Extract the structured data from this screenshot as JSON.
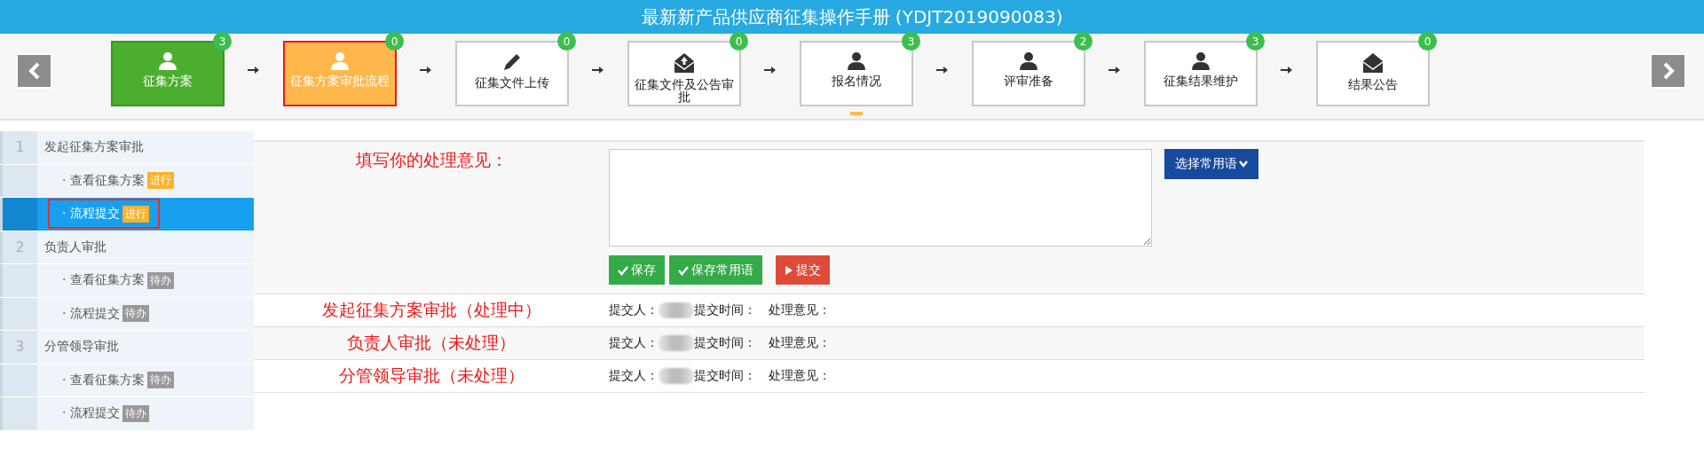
{
  "window": {
    "title": "最新新产品供应商征集操作手册 (YDJT2019090083)"
  },
  "steps": [
    {
      "label": "征集方案",
      "count": "3",
      "done": true,
      "selected": false,
      "current": false
    },
    {
      "label": "征集方案审批流程",
      "count": "0",
      "done": false,
      "selected": true,
      "current": false
    },
    {
      "label": "征集文件上传",
      "count": "0",
      "done": false,
      "selected": false,
      "current": false
    },
    {
      "label": "征集文件及公告审批",
      "count": "0",
      "done": false,
      "selected": false,
      "current": false
    },
    {
      "label": "报名情况",
      "count": "3",
      "done": false,
      "selected": false,
      "current": true
    },
    {
      "label": "评审准备",
      "count": "2",
      "done": false,
      "selected": false,
      "current": false
    },
    {
      "label": "征集结果维护",
      "count": "3",
      "done": false,
      "selected": false,
      "current": false
    },
    {
      "label": "结果公告",
      "count": "0",
      "done": false,
      "selected": false,
      "current": false
    }
  ],
  "sidebar": {
    "groups": [
      {
        "number": "1",
        "title": "发起征集方案审批",
        "children": [
          {
            "label": "· 查看征集方案",
            "badge": {
              "text": "进行",
              "color": "#fbb22c"
            },
            "selected": false
          },
          {
            "label": "· 流程提交",
            "badge": {
              "text": "进行",
              "color": "#fbb22c"
            },
            "selected": true
          }
        ]
      },
      {
        "number": "2",
        "title": "负责人审批",
        "children": [
          {
            "label": "· 查看征集方案",
            "badge": {
              "text": "待办",
              "color": "#999999"
            },
            "selected": false
          },
          {
            "label": "· 流程提交",
            "badge": {
              "text": "待办",
              "color": "#999999"
            },
            "selected": false
          }
        ]
      },
      {
        "number": "3",
        "title": "分管领导审批",
        "children": [
          {
            "label": "· 查看征集方案",
            "badge": {
              "text": "待办",
              "color": "#999999"
            },
            "selected": false
          },
          {
            "label": "· 流程提交",
            "badge": {
              "text": "待办",
              "color": "#999999"
            },
            "selected": false
          }
        ]
      }
    ]
  },
  "form": {
    "label": "填写你的处理意见：",
    "phrase_button": "选择常用语",
    "buttons": [
      {
        "label": "保存",
        "kind": "save"
      },
      {
        "label": "保存常用语",
        "kind": "save"
      },
      {
        "label": "提交",
        "kind": "submit"
      }
    ]
  },
  "records": [
    {
      "stage": "发起征集方案审批（处理中）",
      "submitter_label": "提交人：",
      "time_label": "提交时间：",
      "opinion_label": "处理意见："
    },
    {
      "stage": "负责人审批（未处理）",
      "submitter_label": "提交人：",
      "time_label": "提交时间：",
      "opinion_label": "处理意见："
    },
    {
      "stage": "分管领导审批（未处理）",
      "submitter_label": "提交人：",
      "time_label": "提交时间：",
      "opinion_label": "处理意见："
    }
  ]
}
